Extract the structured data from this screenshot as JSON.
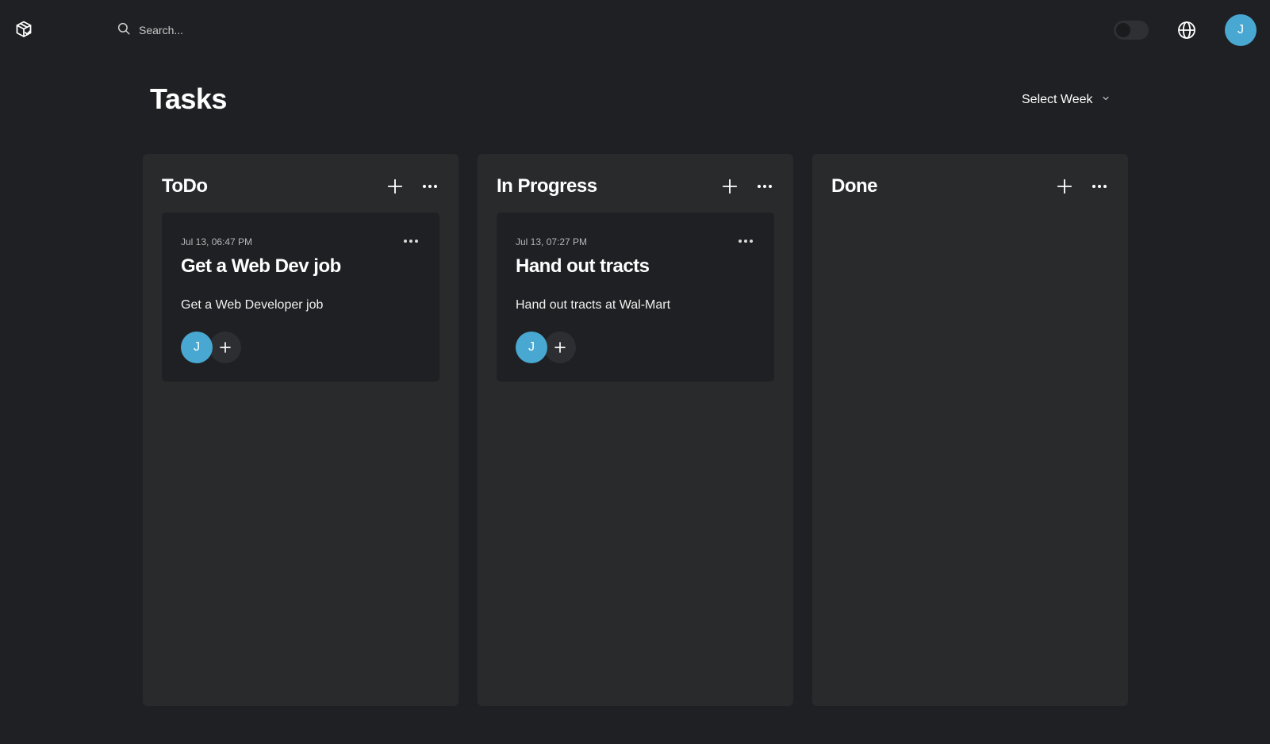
{
  "header": {
    "logo_icon": "package-check-icon",
    "search": {
      "placeholder": "Search...",
      "value": ""
    },
    "theme_toggle": {
      "on": false
    },
    "language_icon": "globe-icon",
    "user_initial": "J"
  },
  "page": {
    "title": "Tasks",
    "week_select_label": "Select Week"
  },
  "columns": [
    {
      "title": "ToDo",
      "cards": [
        {
          "date": "Jul 13, 06:47 PM",
          "title": "Get a Web Dev job",
          "description": "Get a Web Developer job",
          "assignee_initial": "J"
        }
      ]
    },
    {
      "title": "In Progress",
      "cards": [
        {
          "date": "Jul 13, 07:27 PM",
          "title": "Hand out tracts",
          "description": "Hand out tracts at Wal-Mart",
          "assignee_initial": "J"
        }
      ]
    },
    {
      "title": "Done",
      "cards": []
    }
  ],
  "colors": {
    "background": "#1f2023",
    "column": "#282a2c",
    "card": "#1f2023",
    "avatar": "#49a8d1"
  }
}
